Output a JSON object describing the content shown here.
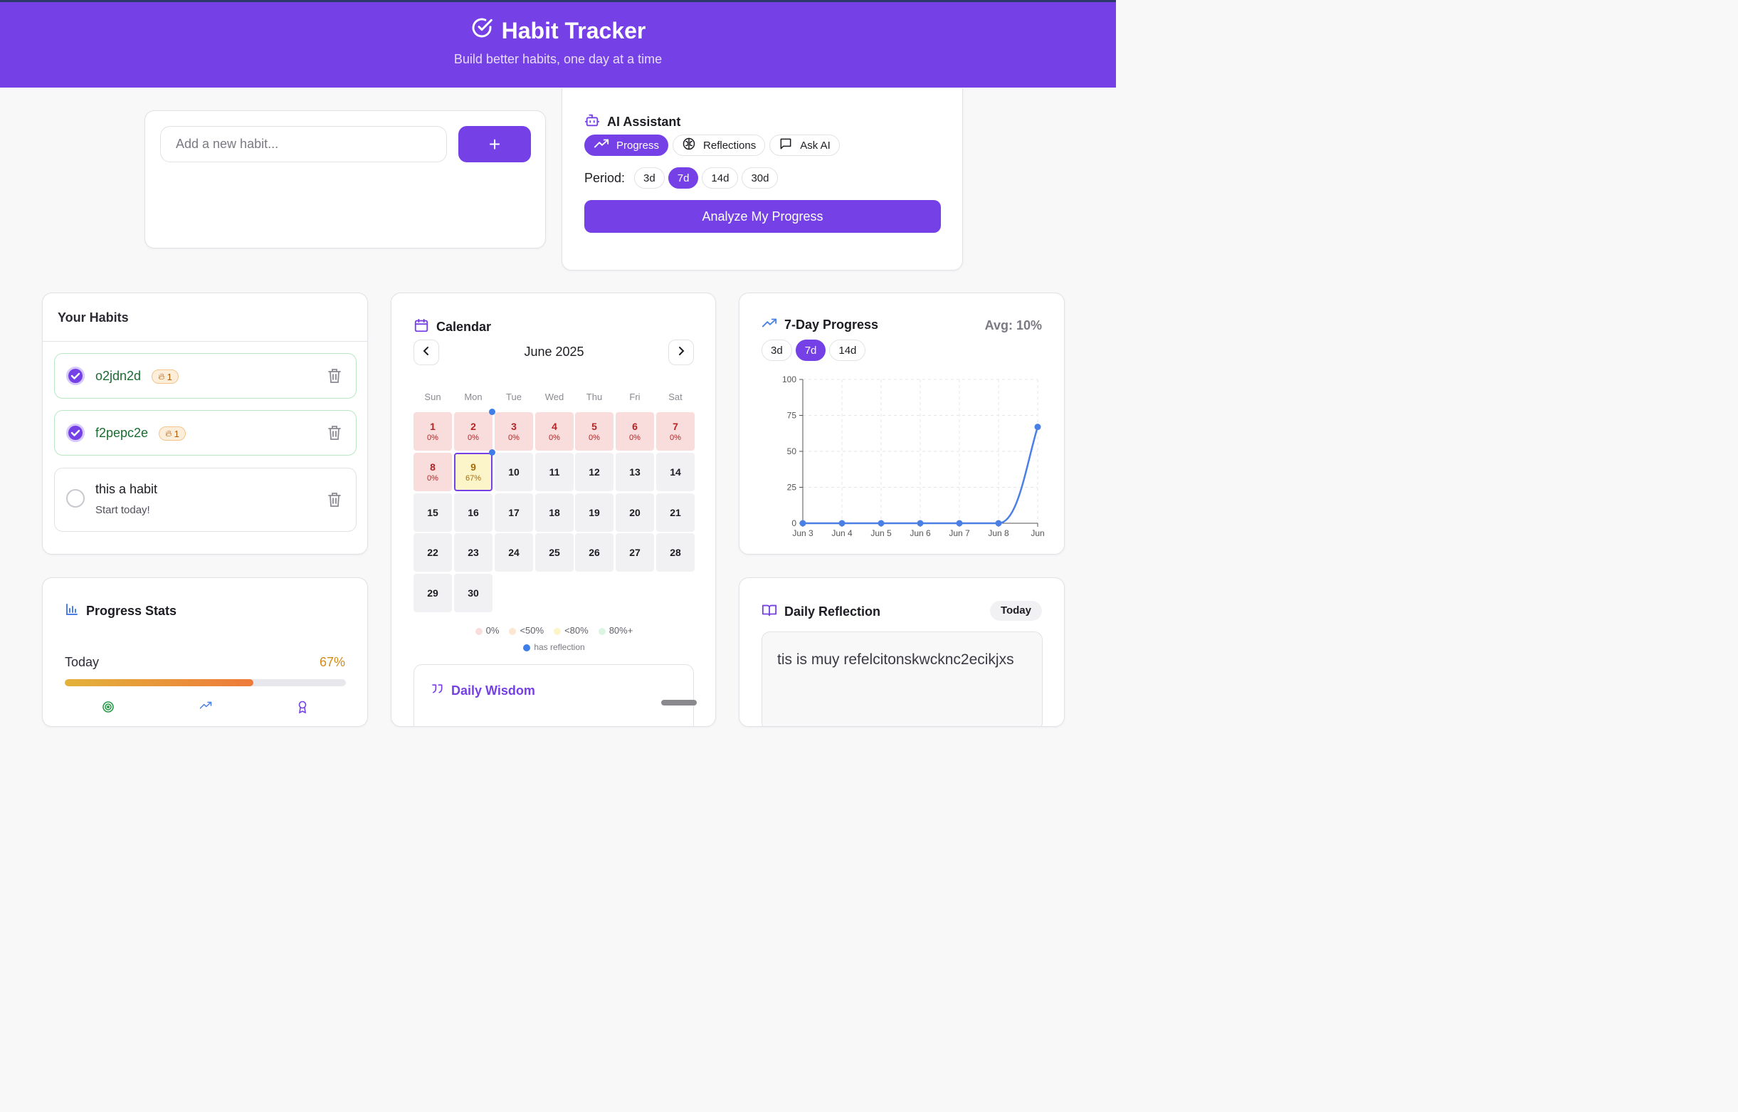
{
  "header": {
    "title": "Habit Tracker",
    "subtitle": "Build better habits, one day at a time"
  },
  "add_habit": {
    "placeholder": "Add a new habit...",
    "button_label": "+"
  },
  "ai": {
    "title": "AI Assistant",
    "tabs": [
      {
        "label": "Progress",
        "icon": "trend-up-icon",
        "active": true
      },
      {
        "label": "Reflections",
        "icon": "brain-icon",
        "active": false
      },
      {
        "label": "Ask AI",
        "icon": "chat-icon",
        "active": false
      }
    ],
    "period_label": "Period:",
    "periods": [
      "3d",
      "7d",
      "14d",
      "30d"
    ],
    "active_period": "7d",
    "analyze_label": "Analyze My Progress"
  },
  "habits": {
    "title": "Your Habits",
    "items": [
      {
        "name": "o2jdn2d",
        "done": true,
        "streak": "1"
      },
      {
        "name": "f2pepc2e",
        "done": true,
        "streak": "1"
      },
      {
        "name": "this a habit",
        "done": false,
        "sub": "Start today!"
      }
    ]
  },
  "calendar": {
    "title": "Calendar",
    "month": "June 2025",
    "weekdays": [
      "Sun",
      "Mon",
      "Tue",
      "Wed",
      "Thu",
      "Fri",
      "Sat"
    ],
    "days": [
      {
        "d": "1",
        "pct": "0%",
        "status": "red"
      },
      {
        "d": "2",
        "pct": "0%",
        "status": "red",
        "reflection": true
      },
      {
        "d": "3",
        "pct": "0%",
        "status": "red"
      },
      {
        "d": "4",
        "pct": "0%",
        "status": "red"
      },
      {
        "d": "5",
        "pct": "0%",
        "status": "red"
      },
      {
        "d": "6",
        "pct": "0%",
        "status": "red"
      },
      {
        "d": "7",
        "pct": "0%",
        "status": "red"
      },
      {
        "d": "8",
        "pct": "0%",
        "status": "red"
      },
      {
        "d": "9",
        "pct": "67%",
        "status": "yellow",
        "reflection": true,
        "today": true
      },
      {
        "d": "10"
      },
      {
        "d": "11"
      },
      {
        "d": "12"
      },
      {
        "d": "13"
      },
      {
        "d": "14"
      },
      {
        "d": "15"
      },
      {
        "d": "16"
      },
      {
        "d": "17"
      },
      {
        "d": "18"
      },
      {
        "d": "19"
      },
      {
        "d": "20"
      },
      {
        "d": "21"
      },
      {
        "d": "22"
      },
      {
        "d": "23"
      },
      {
        "d": "24"
      },
      {
        "d": "25"
      },
      {
        "d": "26"
      },
      {
        "d": "27"
      },
      {
        "d": "28"
      },
      {
        "d": "29"
      },
      {
        "d": "30"
      }
    ],
    "legend": [
      {
        "label": "0%",
        "color": "#f9dcdc"
      },
      {
        "label": "<50%",
        "color": "#fde6d2"
      },
      {
        "label": "<80%",
        "color": "#fcf5c9"
      },
      {
        "label": "80%+",
        "color": "#dcf5e3"
      }
    ],
    "legend_reflection": "has reflection",
    "wisdom_title": "Daily Wisdom"
  },
  "progress": {
    "title": "7-Day Progress",
    "avg": "Avg: 10%",
    "periods": [
      "3d",
      "7d",
      "14d"
    ],
    "active_period": "7d"
  },
  "chart_data": {
    "type": "line",
    "title": "7-Day Progress",
    "x": [
      "Jun 3",
      "Jun 4",
      "Jun 5",
      "Jun 6",
      "Jun 7",
      "Jun 8",
      "Jun"
    ],
    "values": [
      0,
      0,
      0,
      0,
      0,
      0,
      67
    ],
    "yticks": [
      0,
      25,
      50,
      75,
      100
    ],
    "ylim": [
      0,
      100
    ],
    "grid": true,
    "color": "#4a7fe6"
  },
  "stats": {
    "title": "Progress Stats",
    "today_label": "Today",
    "today_pct": "67%",
    "today_value": 67
  },
  "reflection": {
    "title": "Daily Reflection",
    "badge": "Today",
    "text": "tis is muy refelcitonskwcknc2ecikjxs"
  }
}
